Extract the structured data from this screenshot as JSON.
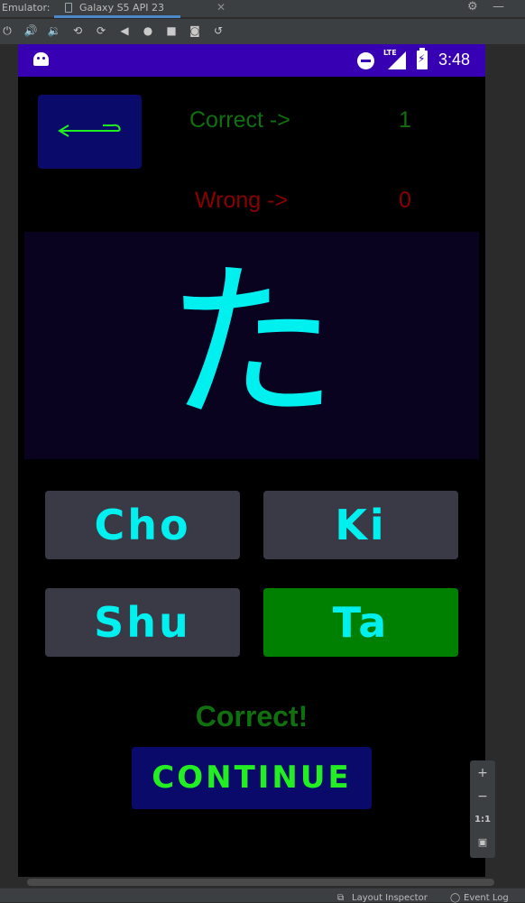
{
  "ide": {
    "emulator_label": "Emulator:",
    "device_tab": "Galaxy S5 API 23",
    "tab_close": "✕",
    "settings_icon": "gear-icon",
    "minimize": "—",
    "zoom_in": "+",
    "zoom_out": "−",
    "zoom_actual": "1:1",
    "layout_inspector": "Layout Inspector",
    "event_log": "Event Log"
  },
  "status_bar": {
    "network": "LTE",
    "time": "3:48",
    "color": "#3700b3"
  },
  "score": {
    "correct_label": "Correct ->",
    "correct_value": "1",
    "wrong_label": "Wrong ->",
    "wrong_value": "0",
    "correct_color": "#107010",
    "wrong_color": "#8a0000"
  },
  "quiz": {
    "character": "た",
    "answers": [
      "Cho",
      "Ki",
      "Shu",
      "Ta"
    ],
    "selected_answer": "Ta",
    "result": "Correct!",
    "continue_label": "CONTINUE"
  },
  "colors": {
    "accent_cyan": "#00f0f0",
    "correct_green": "#008000",
    "button_navy": "#0a0a6a",
    "continue_text": "#22ee22"
  }
}
